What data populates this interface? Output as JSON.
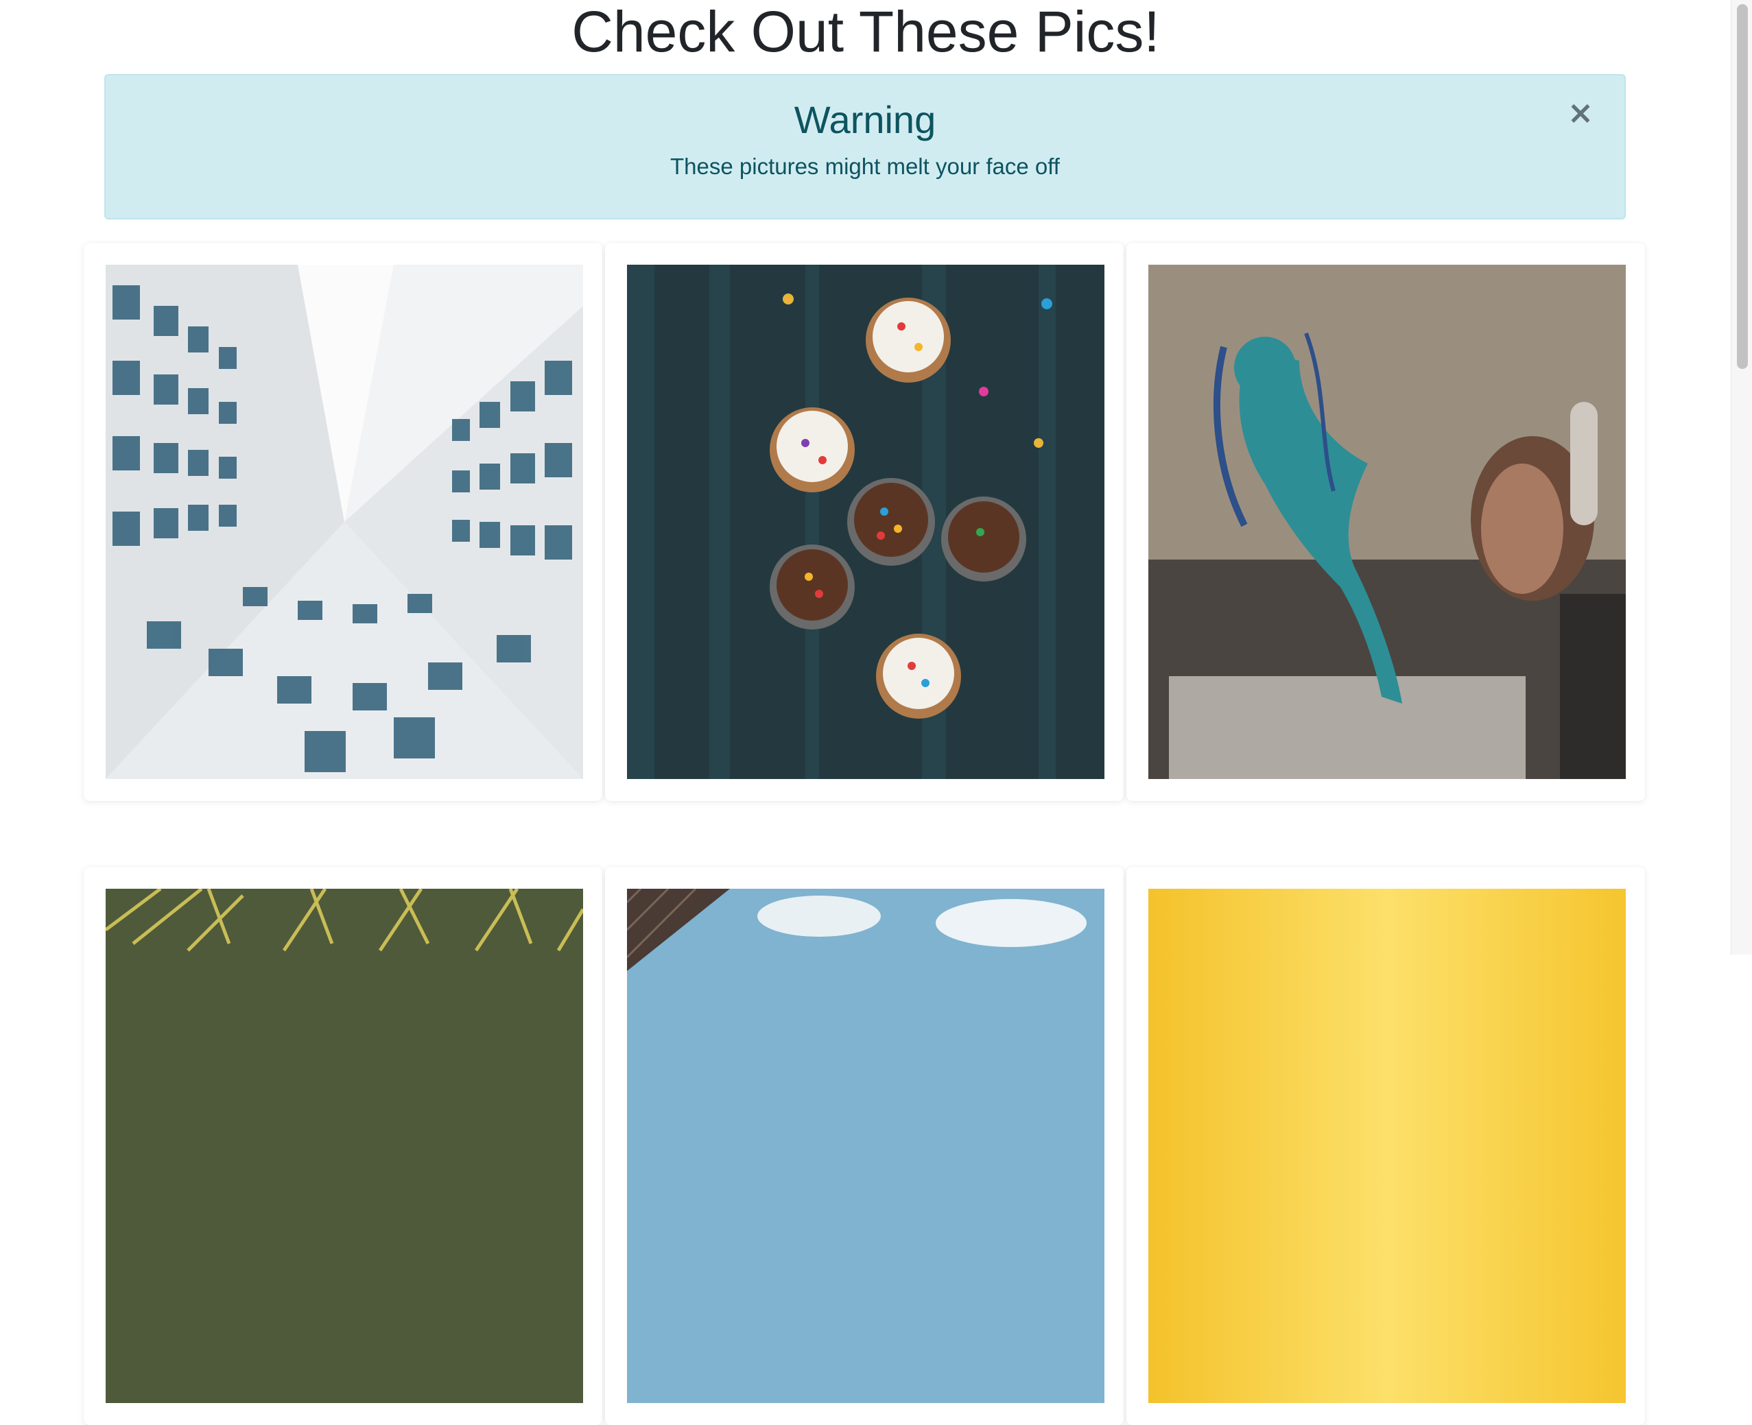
{
  "page": {
    "title": "Check Out These Pics!"
  },
  "alert": {
    "heading": "Warning",
    "message": "These pictures might melt your face off",
    "close_icon": "×",
    "colors": {
      "background": "#d1ecf1",
      "border": "#bee5eb",
      "text": "#0c5460"
    }
  },
  "gallery": {
    "photos": [
      {
        "subject": "building-facade-from-below"
      },
      {
        "subject": "cupcakes-with-sprinkles"
      },
      {
        "subject": "street-art-woman-with-headphones"
      },
      {
        "subject": "palm-leaves"
      },
      {
        "subject": "building-and-sky"
      },
      {
        "subject": "yellow-background"
      }
    ]
  }
}
